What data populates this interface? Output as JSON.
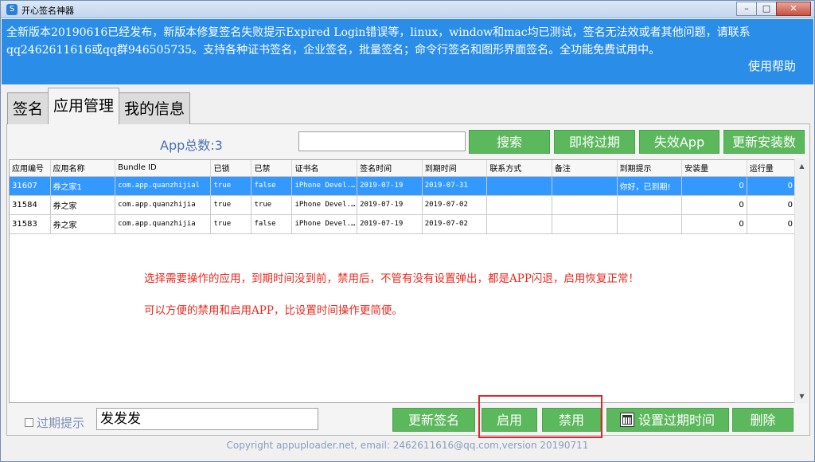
{
  "window": {
    "title": "开心签名神器",
    "controls": {
      "minimize": "–",
      "maximize": "□",
      "close": "✕"
    }
  },
  "banner": {
    "line1": "全新版本20190616已经发布，新版本修复签名失败提示Expired Login错误等，linux，window和mac均已测试，签名无法效或者其他问题，请联系",
    "line2": "qq2462611616或qq群946505735。支持各种证书签名，企业签名，批量签名；命令行签名和图形界面签名。全功能免费试用中。",
    "help": "使用帮助"
  },
  "tabs": [
    "签名",
    "应用管理",
    "我的信息"
  ],
  "toolbar": {
    "app_count": "App总数:3",
    "search_value": "",
    "search": "搜索",
    "expiring": "即将过期",
    "invalid_app": "失效App",
    "update_installs": "更新安装数"
  },
  "table": {
    "columns": [
      "应用编号",
      "应用名称",
      "Bundle ID",
      "已锁",
      "已禁",
      "证书名",
      "签名时间",
      "到期时间",
      "联系方式",
      "备注",
      "到期提示",
      "安装量",
      "运行量"
    ],
    "rows": [
      [
        "31607",
        "券之家1",
        "com.app.quanzhijial",
        "true",
        "false",
        "iPhone Devel...",
        "2019-07-19",
        "2019-07-31",
        "",
        "",
        "你好，已到期!",
        "0",
        "0"
      ],
      [
        "31584",
        "券之家",
        "com.app.quanzhijia",
        "true",
        "true",
        "iPhone Devel...",
        "2019-07-19",
        "2019-07-02",
        "",
        "",
        "",
        "0",
        "0"
      ],
      [
        "31583",
        "券之家",
        "com.app.quanzhijia",
        "true",
        "false",
        "iPhone Devel...",
        "2019-07-19",
        "2019-07-02",
        "",
        "",
        "",
        "0",
        "0"
      ]
    ],
    "selected_row": 0
  },
  "notes": {
    "line1": "选择需要操作的应用，到期时间没到前，禁用后，不管有没有设置弹出，都是APP闪退，启用恢复正常！",
    "line2": "可以方便的禁用和启用APP，比设置时间操作更简便。"
  },
  "bottom": {
    "expire_label": "过期提示",
    "expire_value": "发发发",
    "update_sign": "更新签名",
    "enable": "启用",
    "disable": "禁用",
    "set_expire": "设置过期时间",
    "delete": "删除"
  },
  "footer": "Copyright appuploader.net, email: 2462611616@qq.com,version 20190711",
  "colors": {
    "banner": "#2a8ee8",
    "button": "#5cb85c",
    "selected_row": "#3399ff",
    "note": "#e8291f",
    "highlight": "#e0262a"
  },
  "icons": {
    "app": "app-logo-icon",
    "calendar": "calendar-icon",
    "scroll_up": "triangle-up",
    "scroll_down": "triangle-down"
  }
}
